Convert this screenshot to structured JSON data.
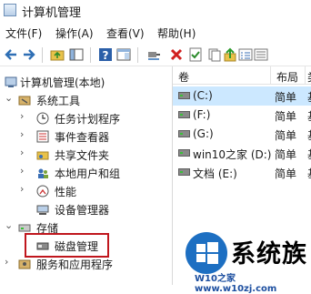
{
  "window": {
    "title": "计算机管理"
  },
  "menu": {
    "items": [
      "文件(F)",
      "操作(A)",
      "查看(V)",
      "帮助(H)"
    ]
  },
  "toolbar": {
    "icons": [
      "back-arrow-icon",
      "forward-arrow-icon",
      "up-folder-icon",
      "console-tree-icon",
      "help-icon",
      "properties-icon",
      "connect-icon",
      "delete-icon",
      "check-icon",
      "copy-icon",
      "up-arrow-icon",
      "settings-icon"
    ]
  },
  "tree": {
    "root": "计算机管理(本地)",
    "system_tools": "系统工具",
    "task_scheduler": "任务计划程序",
    "event_viewer": "事件查看器",
    "shared_folders": "共享文件夹",
    "local_users": "本地用户和组",
    "performance": "性能",
    "device_manager": "设备管理器",
    "storage": "存储",
    "disk_management": "磁盘管理",
    "services_apps": "服务和应用程序"
  },
  "list": {
    "columns": [
      "卷",
      "布局",
      "类"
    ],
    "rows": [
      {
        "volume": "(C:)",
        "layout": "简单",
        "type_cut": "基",
        "selected": true
      },
      {
        "volume": "(F:)",
        "layout": "简单",
        "type_cut": "基",
        "selected": false
      },
      {
        "volume": "(G:)",
        "layout": "简单",
        "type_cut": "基",
        "selected": false
      },
      {
        "volume": "win10之家 (D:)",
        "layout": "简单",
        "type_cut": "基",
        "selected": false
      },
      {
        "volume": "文档 (E:)",
        "layout": "简单",
        "type_cut": "基",
        "selected": false
      }
    ]
  },
  "watermark": {
    "brand": "系统族",
    "url": "W10之家 www.w10zj.com"
  },
  "colors": {
    "highlight_border": "#c0161d",
    "selection": "#cce8ff",
    "logo_blue": "#1d6fc2"
  }
}
